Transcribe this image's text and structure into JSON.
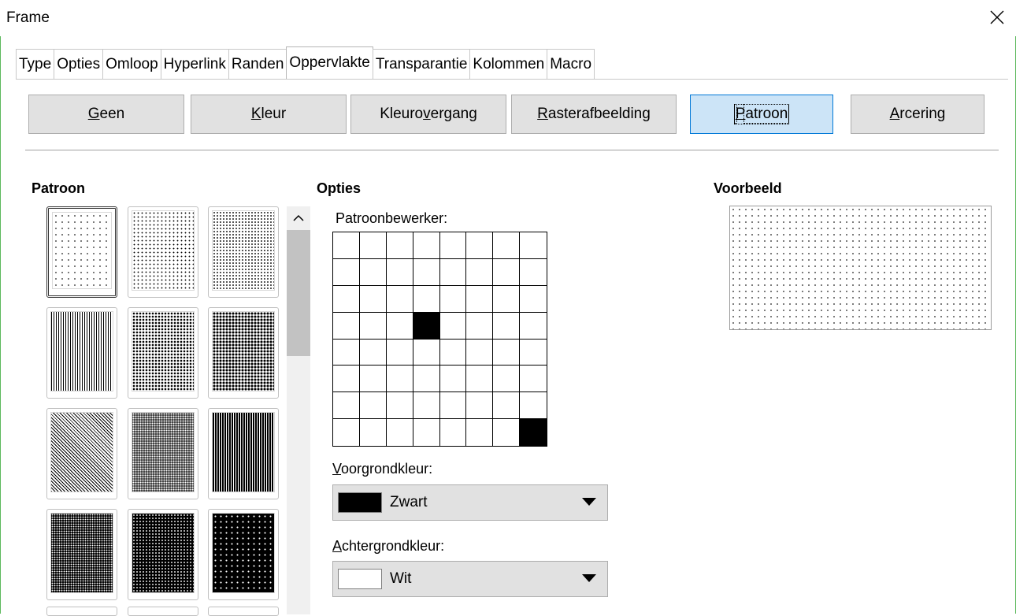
{
  "window": {
    "title": "Frame",
    "close_icon": "close-icon"
  },
  "tabs": [
    "Type",
    "Opties",
    "Omloop",
    "Hyperlink",
    "Randen",
    "Oppervlakte",
    "Transparantie",
    "Kolommen",
    "Macro"
  ],
  "active_tab": "Oppervlakte",
  "fill_buttons": {
    "none": {
      "pre": "",
      "key": "G",
      "post": "een"
    },
    "color": {
      "pre": "",
      "key": "K",
      "post": "leur"
    },
    "gradient": {
      "pre": "Kleuro",
      "key": "v",
      "post": "ergang"
    },
    "bitmap": {
      "pre": "",
      "key": "R",
      "post": "asterafbeelding"
    },
    "pattern": {
      "pre": "",
      "key": "P",
      "post": "atroon"
    },
    "hatch": {
      "pre": "",
      "key": "A",
      "post": "rcering"
    }
  },
  "active_fill": "Patroon",
  "pattern_section": {
    "heading": "Patroon"
  },
  "options_section": {
    "heading": "Opties",
    "editor_label": "Patroonbewerker:",
    "editor_grid": [
      [
        0,
        0,
        0,
        0,
        0,
        0,
        0,
        0
      ],
      [
        0,
        0,
        0,
        0,
        0,
        0,
        0,
        0
      ],
      [
        0,
        0,
        0,
        0,
        0,
        0,
        0,
        0
      ],
      [
        0,
        0,
        0,
        1,
        0,
        0,
        0,
        0
      ],
      [
        0,
        0,
        0,
        0,
        0,
        0,
        0,
        0
      ],
      [
        0,
        0,
        0,
        0,
        0,
        0,
        0,
        0
      ],
      [
        0,
        0,
        0,
        0,
        0,
        0,
        0,
        0
      ],
      [
        0,
        0,
        0,
        0,
        0,
        0,
        0,
        1
      ]
    ],
    "foreground": {
      "label_key": "V",
      "label_rest": "oorgrondkleur:",
      "value": "Zwart",
      "color": "#000000"
    },
    "background": {
      "label_key": "A",
      "label_rest": "chtergrondkleur:",
      "value": "Wit",
      "color": "#ffffff"
    }
  },
  "preview_section": {
    "heading": "Voorbeeld"
  },
  "colors": {
    "accent": "#0078d7",
    "active_button_bg": "#cce4f7",
    "button_bg": "#e1e1e1",
    "frame_border": "#5cb85c"
  }
}
